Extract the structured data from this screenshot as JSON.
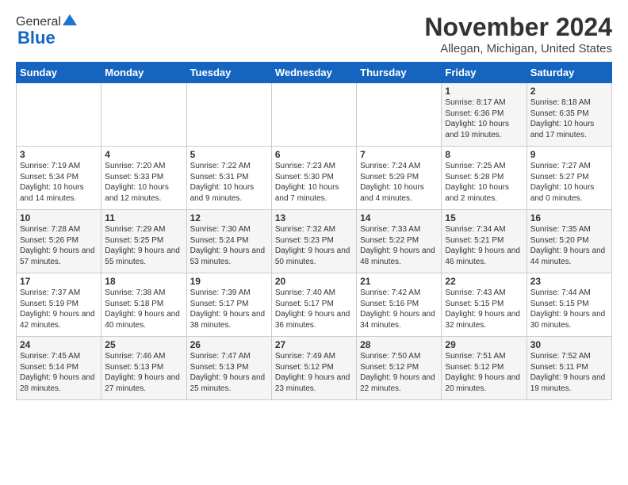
{
  "header": {
    "logo_general": "General",
    "logo_blue": "Blue",
    "title": "November 2024",
    "subtitle": "Allegan, Michigan, United States"
  },
  "weekdays": [
    "Sunday",
    "Monday",
    "Tuesday",
    "Wednesday",
    "Thursday",
    "Friday",
    "Saturday"
  ],
  "weeks": [
    [
      {
        "day": "",
        "info": ""
      },
      {
        "day": "",
        "info": ""
      },
      {
        "day": "",
        "info": ""
      },
      {
        "day": "",
        "info": ""
      },
      {
        "day": "",
        "info": ""
      },
      {
        "day": "1",
        "info": "Sunrise: 8:17 AM\nSunset: 6:36 PM\nDaylight: 10 hours and 19 minutes."
      },
      {
        "day": "2",
        "info": "Sunrise: 8:18 AM\nSunset: 6:35 PM\nDaylight: 10 hours and 17 minutes."
      }
    ],
    [
      {
        "day": "3",
        "info": "Sunrise: 7:19 AM\nSunset: 5:34 PM\nDaylight: 10 hours and 14 minutes."
      },
      {
        "day": "4",
        "info": "Sunrise: 7:20 AM\nSunset: 5:33 PM\nDaylight: 10 hours and 12 minutes."
      },
      {
        "day": "5",
        "info": "Sunrise: 7:22 AM\nSunset: 5:31 PM\nDaylight: 10 hours and 9 minutes."
      },
      {
        "day": "6",
        "info": "Sunrise: 7:23 AM\nSunset: 5:30 PM\nDaylight: 10 hours and 7 minutes."
      },
      {
        "day": "7",
        "info": "Sunrise: 7:24 AM\nSunset: 5:29 PM\nDaylight: 10 hours and 4 minutes."
      },
      {
        "day": "8",
        "info": "Sunrise: 7:25 AM\nSunset: 5:28 PM\nDaylight: 10 hours and 2 minutes."
      },
      {
        "day": "9",
        "info": "Sunrise: 7:27 AM\nSunset: 5:27 PM\nDaylight: 10 hours and 0 minutes."
      }
    ],
    [
      {
        "day": "10",
        "info": "Sunrise: 7:28 AM\nSunset: 5:26 PM\nDaylight: 9 hours and 57 minutes."
      },
      {
        "day": "11",
        "info": "Sunrise: 7:29 AM\nSunset: 5:25 PM\nDaylight: 9 hours and 55 minutes."
      },
      {
        "day": "12",
        "info": "Sunrise: 7:30 AM\nSunset: 5:24 PM\nDaylight: 9 hours and 53 minutes."
      },
      {
        "day": "13",
        "info": "Sunrise: 7:32 AM\nSunset: 5:23 PM\nDaylight: 9 hours and 50 minutes."
      },
      {
        "day": "14",
        "info": "Sunrise: 7:33 AM\nSunset: 5:22 PM\nDaylight: 9 hours and 48 minutes."
      },
      {
        "day": "15",
        "info": "Sunrise: 7:34 AM\nSunset: 5:21 PM\nDaylight: 9 hours and 46 minutes."
      },
      {
        "day": "16",
        "info": "Sunrise: 7:35 AM\nSunset: 5:20 PM\nDaylight: 9 hours and 44 minutes."
      }
    ],
    [
      {
        "day": "17",
        "info": "Sunrise: 7:37 AM\nSunset: 5:19 PM\nDaylight: 9 hours and 42 minutes."
      },
      {
        "day": "18",
        "info": "Sunrise: 7:38 AM\nSunset: 5:18 PM\nDaylight: 9 hours and 40 minutes."
      },
      {
        "day": "19",
        "info": "Sunrise: 7:39 AM\nSunset: 5:17 PM\nDaylight: 9 hours and 38 minutes."
      },
      {
        "day": "20",
        "info": "Sunrise: 7:40 AM\nSunset: 5:17 PM\nDaylight: 9 hours and 36 minutes."
      },
      {
        "day": "21",
        "info": "Sunrise: 7:42 AM\nSunset: 5:16 PM\nDaylight: 9 hours and 34 minutes."
      },
      {
        "day": "22",
        "info": "Sunrise: 7:43 AM\nSunset: 5:15 PM\nDaylight: 9 hours and 32 minutes."
      },
      {
        "day": "23",
        "info": "Sunrise: 7:44 AM\nSunset: 5:15 PM\nDaylight: 9 hours and 30 minutes."
      }
    ],
    [
      {
        "day": "24",
        "info": "Sunrise: 7:45 AM\nSunset: 5:14 PM\nDaylight: 9 hours and 28 minutes."
      },
      {
        "day": "25",
        "info": "Sunrise: 7:46 AM\nSunset: 5:13 PM\nDaylight: 9 hours and 27 minutes."
      },
      {
        "day": "26",
        "info": "Sunrise: 7:47 AM\nSunset: 5:13 PM\nDaylight: 9 hours and 25 minutes."
      },
      {
        "day": "27",
        "info": "Sunrise: 7:49 AM\nSunset: 5:12 PM\nDaylight: 9 hours and 23 minutes."
      },
      {
        "day": "28",
        "info": "Sunrise: 7:50 AM\nSunset: 5:12 PM\nDaylight: 9 hours and 22 minutes."
      },
      {
        "day": "29",
        "info": "Sunrise: 7:51 AM\nSunset: 5:12 PM\nDaylight: 9 hours and 20 minutes."
      },
      {
        "day": "30",
        "info": "Sunrise: 7:52 AM\nSunset: 5:11 PM\nDaylight: 9 hours and 19 minutes."
      }
    ]
  ]
}
